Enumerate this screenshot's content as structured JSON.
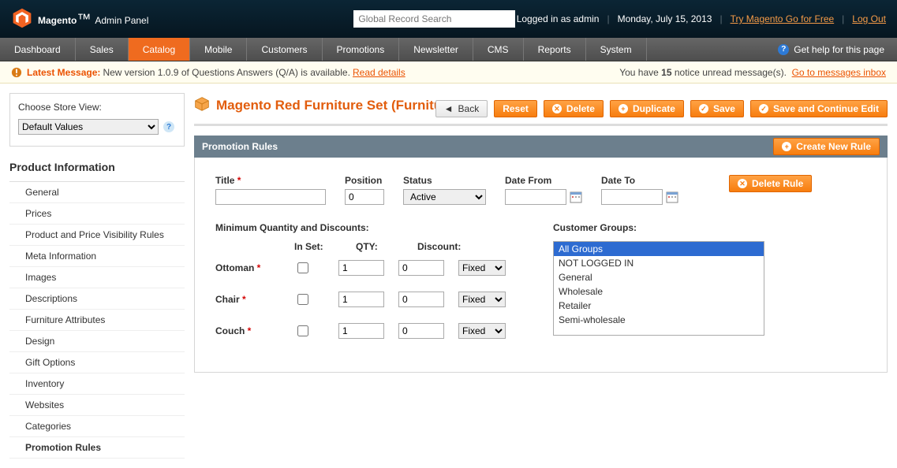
{
  "header": {
    "brand_main": "Magento",
    "brand_sub": "Admin Panel",
    "search_placeholder": "Global Record Search",
    "logged_in": "Logged in as admin",
    "date": "Monday, July 15, 2013",
    "try_link": "Try Magento Go for Free",
    "logout": "Log Out"
  },
  "nav": {
    "items": [
      "Dashboard",
      "Sales",
      "Catalog",
      "Mobile",
      "Customers",
      "Promotions",
      "Newsletter",
      "CMS",
      "Reports",
      "System"
    ],
    "active_index": 2,
    "help": "Get help for this page"
  },
  "message": {
    "label": "Latest Message:",
    "text": "New version 1.0.9 of Questions Answers (Q/A) is available.",
    "link": "Read details",
    "right_a": "You have ",
    "notice_count": "15",
    "right_b": " notice unread message(s).",
    "right_link": "Go to messages inbox"
  },
  "store": {
    "label": "Choose Store View:",
    "value": "Default Values"
  },
  "sidebar": {
    "heading": "Product Information",
    "items": [
      "General",
      "Prices",
      "Product and Price Visibility Rules",
      "Meta Information",
      "Images",
      "Descriptions",
      "Furniture Attributes",
      "Design",
      "Gift Options",
      "Inventory",
      "Websites",
      "Categories",
      "Promotion Rules"
    ],
    "active_index": 12
  },
  "page": {
    "title": "Magento Red Furniture Set (Furniture)"
  },
  "actions": {
    "back": "Back",
    "reset": "Reset",
    "delete": "Delete",
    "duplicate": "Duplicate",
    "save": "Save",
    "save_continue": "Save and Continue Edit"
  },
  "section": {
    "title": "Promotion Rules",
    "create": "Create New Rule",
    "delete_rule": "Delete Rule",
    "labels": {
      "title": "Title",
      "position": "Position",
      "status": "Status",
      "date_from": "Date From",
      "date_to": "Date To"
    },
    "values": {
      "title": "",
      "position": "0",
      "status": "Active",
      "date_from": "",
      "date_to": ""
    },
    "discounts_title": "Minimum Quantity and Discounts:",
    "groups_title": "Customer Groups:",
    "dhead": {
      "inset": "In Set:",
      "qty": "QTY:",
      "discount": "Discount:"
    },
    "rows": [
      {
        "name": "Ottoman",
        "qty": "1",
        "disc": "0",
        "type": "Fixed"
      },
      {
        "name": "Chair",
        "qty": "1",
        "disc": "0",
        "type": "Fixed"
      },
      {
        "name": "Couch",
        "qty": "1",
        "disc": "0",
        "type": "Fixed"
      }
    ],
    "groups": [
      "All Groups",
      "NOT LOGGED IN",
      "General",
      "Wholesale",
      "Retailer",
      "Semi-wholesale"
    ],
    "group_selected_index": 0
  }
}
